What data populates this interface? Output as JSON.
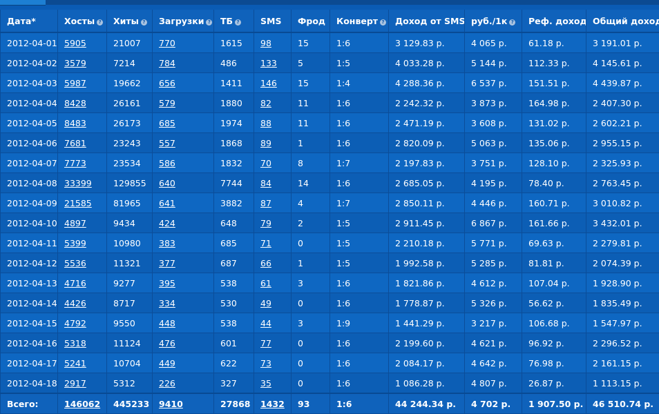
{
  "table": {
    "columns": [
      {
        "key": "date",
        "label": "Дата*",
        "help": false
      },
      {
        "key": "hosts",
        "label": "Хосты",
        "help": true
      },
      {
        "key": "hits",
        "label": "Хиты",
        "help": true
      },
      {
        "key": "downloads",
        "label": "Загрузки",
        "help": true
      },
      {
        "key": "tb",
        "label": "ТБ",
        "help": true
      },
      {
        "key": "sms",
        "label": "SMS",
        "help": false
      },
      {
        "key": "fraud",
        "label": "Фрод",
        "help": false
      },
      {
        "key": "convert",
        "label": "Конверт",
        "help": true
      },
      {
        "key": "sms_income",
        "label": "Доход от SMS",
        "help": false
      },
      {
        "key": "rub_per_1k",
        "label": "руб./1к",
        "help": true
      },
      {
        "key": "ref_income",
        "label": "Реф. доход",
        "help": false
      },
      {
        "key": "total_income",
        "label": "Общий доход",
        "help": false
      }
    ],
    "rows": [
      [
        "2012-04-01",
        "5905",
        "21007",
        "770",
        "1615",
        "98",
        "15",
        "1:6",
        "3 129.83 р.",
        "4 065 р.",
        "61.18 р.",
        "3 191.01 р."
      ],
      [
        "2012-04-02",
        "3579",
        "7214",
        "784",
        "486",
        "133",
        "5",
        "1:5",
        "4 033.28 р.",
        "5 144 р.",
        "112.33 р.",
        "4 145.61 р."
      ],
      [
        "2012-04-03",
        "5987",
        "19662",
        "656",
        "1411",
        "146",
        "15",
        "1:4",
        "4 288.36 р.",
        "6 537 р.",
        "151.51 р.",
        "4 439.87 р."
      ],
      [
        "2012-04-04",
        "8428",
        "26161",
        "579",
        "1880",
        "82",
        "11",
        "1:6",
        "2 242.32 р.",
        "3 873 р.",
        "164.98 р.",
        "2 407.30 р."
      ],
      [
        "2012-04-05",
        "8483",
        "26173",
        "685",
        "1974",
        "88",
        "11",
        "1:6",
        "2 471.19 р.",
        "3 608 р.",
        "131.02 р.",
        "2 602.21 р."
      ],
      [
        "2012-04-06",
        "7681",
        "23243",
        "557",
        "1868",
        "89",
        "1",
        "1:6",
        "2 820.09 р.",
        "5 063 р.",
        "135.06 р.",
        "2 955.15 р."
      ],
      [
        "2012-04-07",
        "7773",
        "23534",
        "586",
        "1832",
        "70",
        "8",
        "1:7",
        "2 197.83 р.",
        "3 751 р.",
        "128.10 р.",
        "2 325.93 р."
      ],
      [
        "2012-04-08",
        "33399",
        "129855",
        "640",
        "7744",
        "84",
        "14",
        "1:6",
        "2 685.05 р.",
        "4 195 р.",
        "78.40 р.",
        "2 763.45 р."
      ],
      [
        "2012-04-09",
        "21585",
        "81965",
        "641",
        "3882",
        "87",
        "4",
        "1:7",
        "2 850.11 р.",
        "4 446 р.",
        "160.71 р.",
        "3 010.82 р."
      ],
      [
        "2012-04-10",
        "4897",
        "9434",
        "424",
        "648",
        "79",
        "2",
        "1:5",
        "2 911.45 р.",
        "6 867 р.",
        "161.66 р.",
        "3 432.01 р."
      ],
      [
        "2012-04-11",
        "5399",
        "10980",
        "383",
        "685",
        "71",
        "0",
        "1:5",
        "2 210.18 р.",
        "5 771 р.",
        "69.63 р.",
        "2 279.81 р."
      ],
      [
        "2012-04-12",
        "5536",
        "11321",
        "377",
        "687",
        "66",
        "1",
        "1:5",
        "1 992.58 р.",
        "5 285 р.",
        "81.81 р.",
        "2 074.39 р."
      ],
      [
        "2012-04-13",
        "4716",
        "9277",
        "395",
        "538",
        "61",
        "3",
        "1:6",
        "1 821.86 р.",
        "4 612 р.",
        "107.04 р.",
        "1 928.90 р."
      ],
      [
        "2012-04-14",
        "4426",
        "8717",
        "334",
        "530",
        "49",
        "0",
        "1:6",
        "1 778.87 р.",
        "5 326 р.",
        "56.62 р.",
        "1 835.49 р."
      ],
      [
        "2012-04-15",
        "4792",
        "9550",
        "448",
        "538",
        "44",
        "3",
        "1:9",
        "1 441.29 р.",
        "3 217 р.",
        "106.68 р.",
        "1 547.97 р."
      ],
      [
        "2012-04-16",
        "5318",
        "11124",
        "476",
        "601",
        "77",
        "0",
        "1:6",
        "2 199.60 р.",
        "4 621 р.",
        "96.92 р.",
        "2 296.52 р."
      ],
      [
        "2012-04-17",
        "5241",
        "10704",
        "449",
        "622",
        "73",
        "0",
        "1:6",
        "2 084.17 р.",
        "4 642 р.",
        "76.98 р.",
        "2 161.15 р."
      ],
      [
        "2012-04-18",
        "2917",
        "5312",
        "226",
        "327",
        "35",
        "0",
        "1:6",
        "1 086.28 р.",
        "4 807 р.",
        "26.87 р.",
        "1 113.15 р."
      ]
    ],
    "totals": [
      "Всего:",
      "146062",
      "445233",
      "9410",
      "27868",
      "1432",
      "93",
      "1:6",
      "44 244.34 р.",
      "4 702 р.",
      "1 907.50 р.",
      "46 510.74 р."
    ],
    "link_columns": [
      1,
      3,
      5
    ]
  }
}
